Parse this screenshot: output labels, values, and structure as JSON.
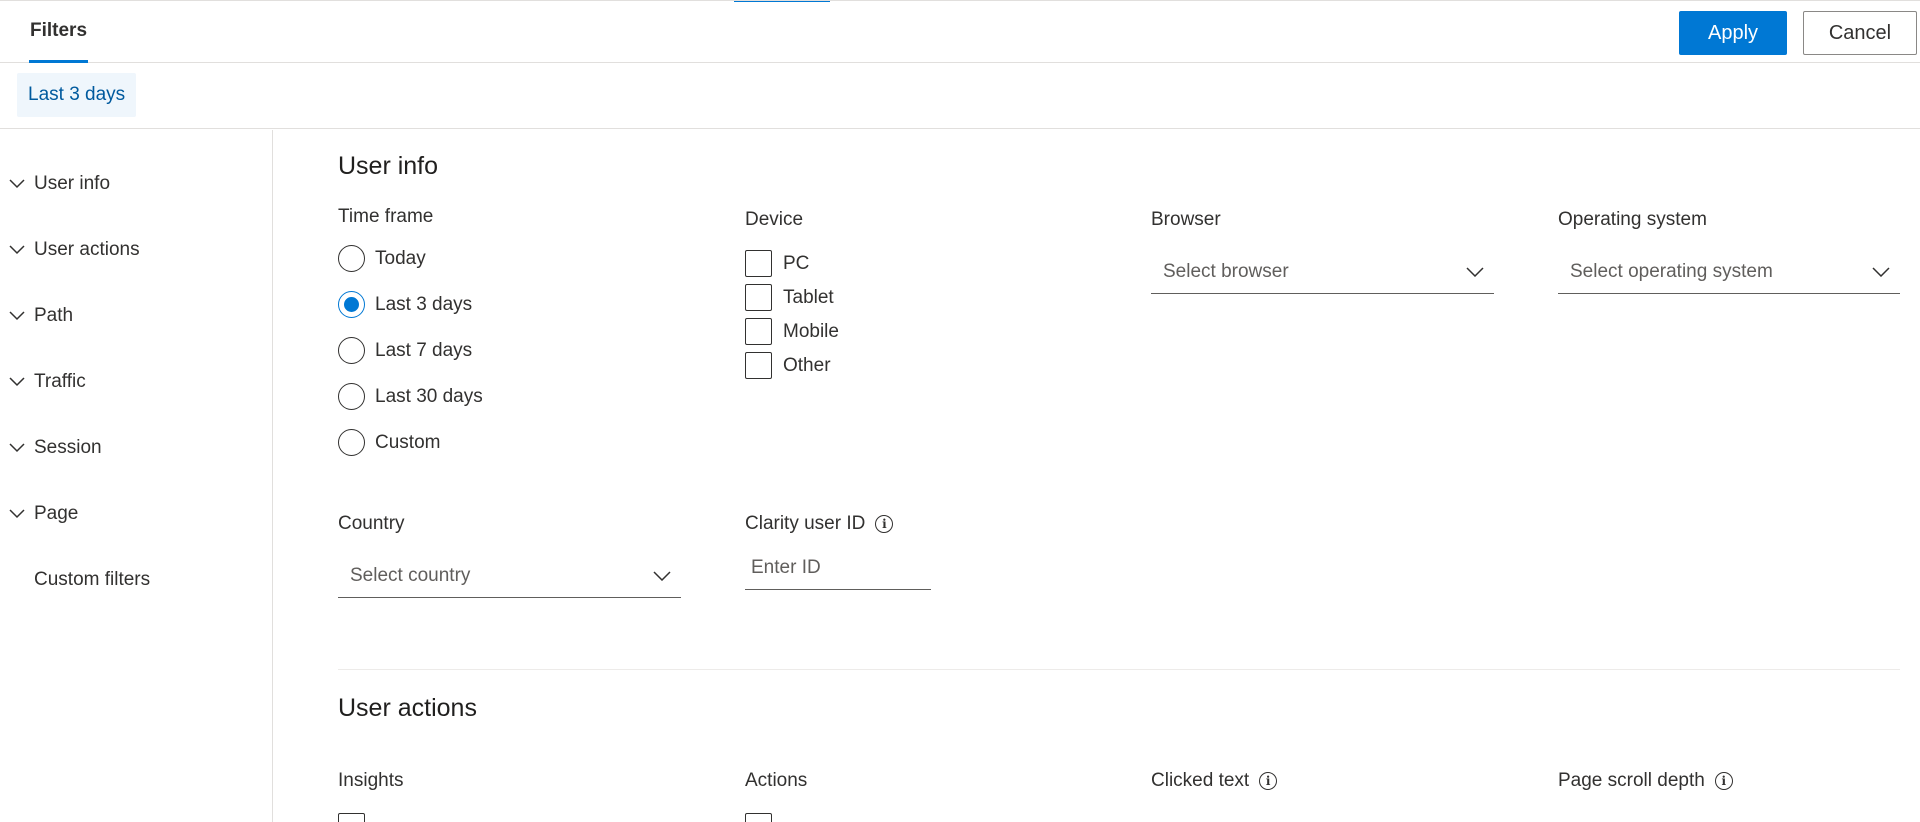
{
  "header": {
    "tab_label": "Filters",
    "apply_label": "Apply",
    "cancel_label": "Cancel"
  },
  "chips": {
    "active": "Last 3 days"
  },
  "sidebar": {
    "items": [
      {
        "label": "User info",
        "expandable": true
      },
      {
        "label": "User actions",
        "expandable": true
      },
      {
        "label": "Path",
        "expandable": true
      },
      {
        "label": "Traffic",
        "expandable": true
      },
      {
        "label": "Session",
        "expandable": true
      },
      {
        "label": "Page",
        "expandable": true
      },
      {
        "label": "Custom filters",
        "expandable": false
      }
    ]
  },
  "user_info": {
    "title": "User info",
    "time_frame": {
      "label": "Time frame",
      "options": [
        "Today",
        "Last 3 days",
        "Last 7 days",
        "Last 30 days",
        "Custom"
      ],
      "selected": "Last 3 days"
    },
    "device": {
      "label": "Device",
      "options": [
        "PC",
        "Tablet",
        "Mobile",
        "Other"
      ]
    },
    "browser": {
      "label": "Browser",
      "placeholder": "Select browser"
    },
    "os": {
      "label": "Operating system",
      "placeholder": "Select operating system"
    },
    "country": {
      "label": "Country",
      "placeholder": "Select country"
    },
    "clarity_id": {
      "label": "Clarity user ID",
      "placeholder": "Enter ID"
    }
  },
  "user_actions": {
    "title": "User actions",
    "insights_label": "Insights",
    "actions_label": "Actions",
    "clicked_text_label": "Clicked text",
    "scroll_depth_label": "Page scroll depth"
  },
  "colors": {
    "accent": "#0078d4",
    "chip_bg": "#eff6fc",
    "chip_text": "#005a9e"
  }
}
